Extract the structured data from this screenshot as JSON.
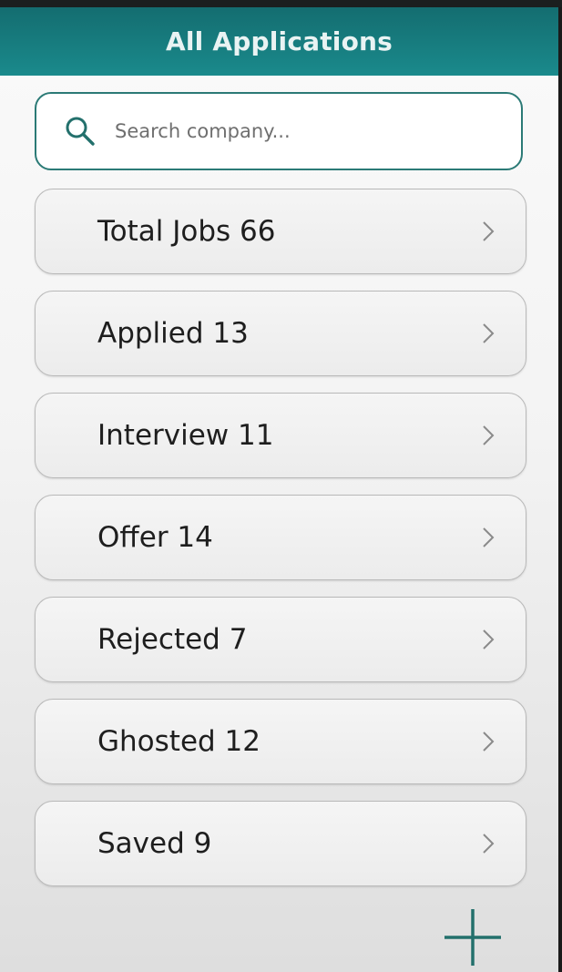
{
  "header": {
    "title": "All Applications"
  },
  "search": {
    "placeholder": "Search company...",
    "value": "",
    "icon": "search-icon"
  },
  "categories": [
    {
      "label": "Total Jobs 66",
      "icon": "chevron-right-icon"
    },
    {
      "label": "Applied 13",
      "icon": "chevron-right-icon"
    },
    {
      "label": "Interview 11",
      "icon": "chevron-right-icon"
    },
    {
      "label": "Offer 14",
      "icon": "chevron-right-icon"
    },
    {
      "label": "Rejected 7",
      "icon": "chevron-right-icon"
    },
    {
      "label": "Ghosted 12",
      "icon": "chevron-right-icon"
    },
    {
      "label": "Saved 9",
      "icon": "chevron-right-icon"
    }
  ],
  "fab": {
    "icon": "plus-icon"
  },
  "colors": {
    "header_bg": "#1a7f82",
    "accent": "#23706c",
    "text": "#1e1e1e"
  }
}
